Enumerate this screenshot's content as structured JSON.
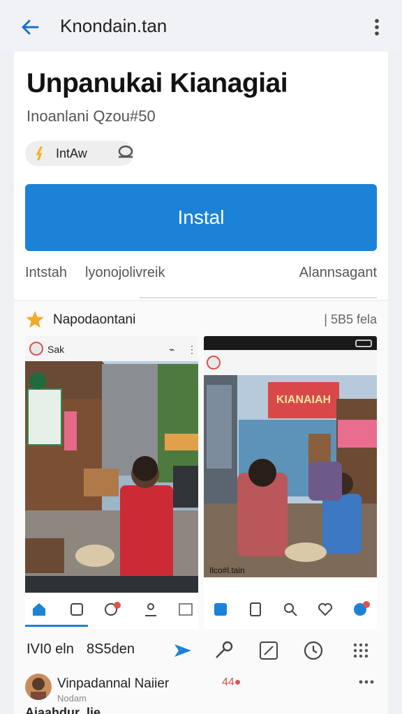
{
  "topbar": {
    "title": "Knondain.tan"
  },
  "app": {
    "title": "Unpanukai Kianagiai",
    "subtitle": "Inoanlani Qzou#50",
    "chip_label": "IntAw",
    "install_label": "Instal",
    "meta": [
      "Intstah",
      "lyonojolivreik",
      "Alannsagant"
    ]
  },
  "ratings": {
    "label": "Napodaontani",
    "count": "| 5B5 fela"
  },
  "screenshot1": {
    "tab_label": "Sak",
    "nav_icons": [
      "home-icon",
      "bookmark-icon",
      "chat-icon",
      "profile-icon",
      "image-icon"
    ],
    "nav_badge": "R"
  },
  "screenshot2": {
    "sign_text": "KIANAIAH",
    "caption": "Ilco#l.tain",
    "nav_icons": [
      "save-icon",
      "list-icon",
      "search-icon",
      "heart-icon",
      "notification-icon"
    ],
    "nav_badge": "R"
  },
  "bottom_row": {
    "label_a": "IVI0 eln",
    "label_b": "8S5den",
    "icons": [
      "send-icon",
      "key-icon",
      "translate-icon",
      "clock-icon",
      "qr-code-icon"
    ]
  },
  "review": {
    "name": "Vinpadannal Naiier",
    "sub": "Nodam",
    "badge": "44●",
    "next_title": "Ajaahdur .lie"
  },
  "colors": {
    "accent": "#1c82d8",
    "star": "#f4a82a",
    "card": "#ffffff",
    "background": "#eef0f3"
  }
}
